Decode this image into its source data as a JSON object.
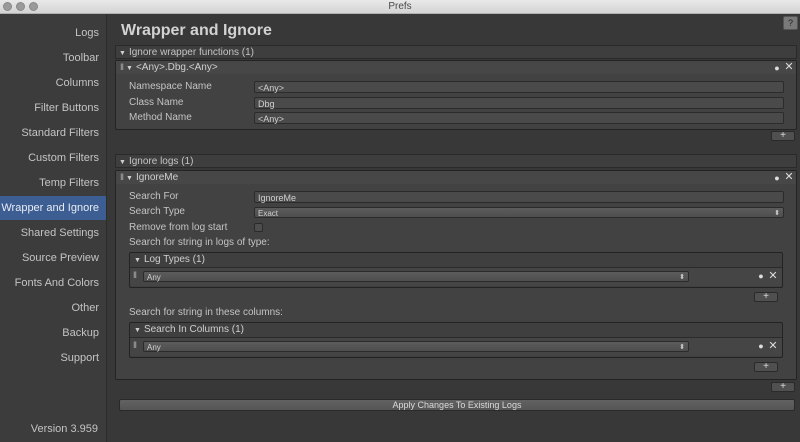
{
  "window": {
    "title": "Prefs"
  },
  "sidebar": {
    "items": [
      {
        "label": "Logs"
      },
      {
        "label": "Toolbar"
      },
      {
        "label": "Columns"
      },
      {
        "label": "Filter Buttons"
      },
      {
        "label": "Standard Filters"
      },
      {
        "label": "Custom Filters"
      },
      {
        "label": "Temp Filters"
      },
      {
        "label": "Wrapper and Ignore"
      },
      {
        "label": "Shared Settings"
      },
      {
        "label": "Source Preview"
      },
      {
        "label": "Fonts And Colors"
      },
      {
        "label": "Other"
      },
      {
        "label": "Backup"
      },
      {
        "label": "Support"
      }
    ],
    "active_index": 7,
    "version": "Version 3.959"
  },
  "page": {
    "title": "Wrapper and Ignore",
    "help_label": "?"
  },
  "wrapper_section": {
    "header": "Ignore wrapper functions (1)",
    "entry": {
      "title": "<Any>.Dbg.<Any>",
      "fields": [
        {
          "label": "Namespace Name",
          "value": "<Any>"
        },
        {
          "label": "Class Name",
          "value": "Dbg"
        },
        {
          "label": "Method Name",
          "value": "<Any>"
        }
      ]
    },
    "add_label": "+"
  },
  "ignore_section": {
    "header": "Ignore logs (1)",
    "entry": {
      "title": "IgnoreMe",
      "search_for_label": "Search For",
      "search_for_value": "IgnoreMe",
      "search_type_label": "Search Type",
      "search_type_value": "Exact",
      "remove_label": "Remove from log start",
      "search_in_types_label": "Search for string in logs of type:",
      "log_types": {
        "header": "Log Types (1)",
        "value": "Any",
        "add_label": "+"
      },
      "search_in_columns_label": "Search for string in these columns:",
      "columns": {
        "header": "Search In Columns (1)",
        "value": "Any",
        "add_label": "+"
      }
    },
    "add_label": "+"
  },
  "apply_button": "Apply Changes To Existing Logs",
  "icons": {
    "eye": "eye-icon",
    "close": "close-icon",
    "triangle": "triangle-down-icon",
    "drag": "drag-handle-icon"
  },
  "colors": {
    "active_item": "#3d5e92"
  }
}
